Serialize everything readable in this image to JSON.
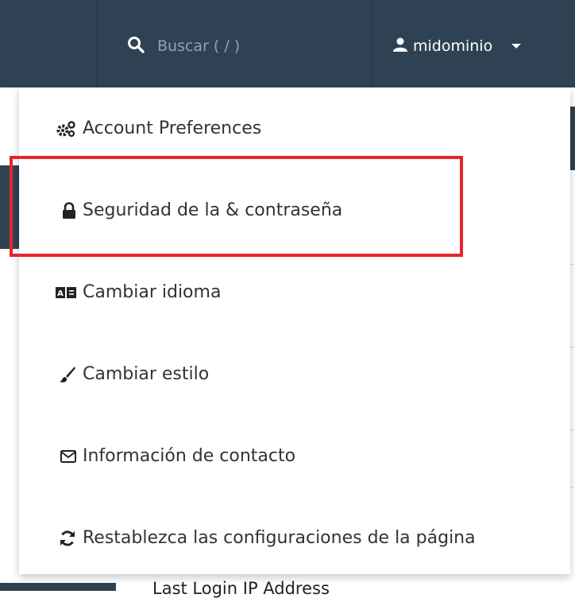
{
  "header": {
    "search": {
      "placeholder": "Buscar ( / )",
      "icon": "search-icon"
    },
    "user": {
      "username": "midominio",
      "icon": "user-icon",
      "caret_icon": "caret-down-icon"
    }
  },
  "menu": {
    "items": [
      {
        "label": "Account Preferences",
        "icon": "cogs-icon"
      },
      {
        "label": "Seguridad de la & contraseña",
        "icon": "lock-icon",
        "highlighted": true
      },
      {
        "label": "Cambiar idioma",
        "icon": "language-icon"
      },
      {
        "label": "Cambiar estilo",
        "icon": "brush-icon"
      },
      {
        "label": "Información de contacto",
        "icon": "envelope-icon"
      },
      {
        "label": "Restablezca las configuraciones de la página",
        "icon": "refresh-icon"
      }
    ]
  },
  "background": {
    "peek_label": "Last Login IP Address"
  },
  "colors": {
    "header_bg": "#2f4253",
    "highlight_border": "#e8242b",
    "menu_text": "#333333"
  }
}
